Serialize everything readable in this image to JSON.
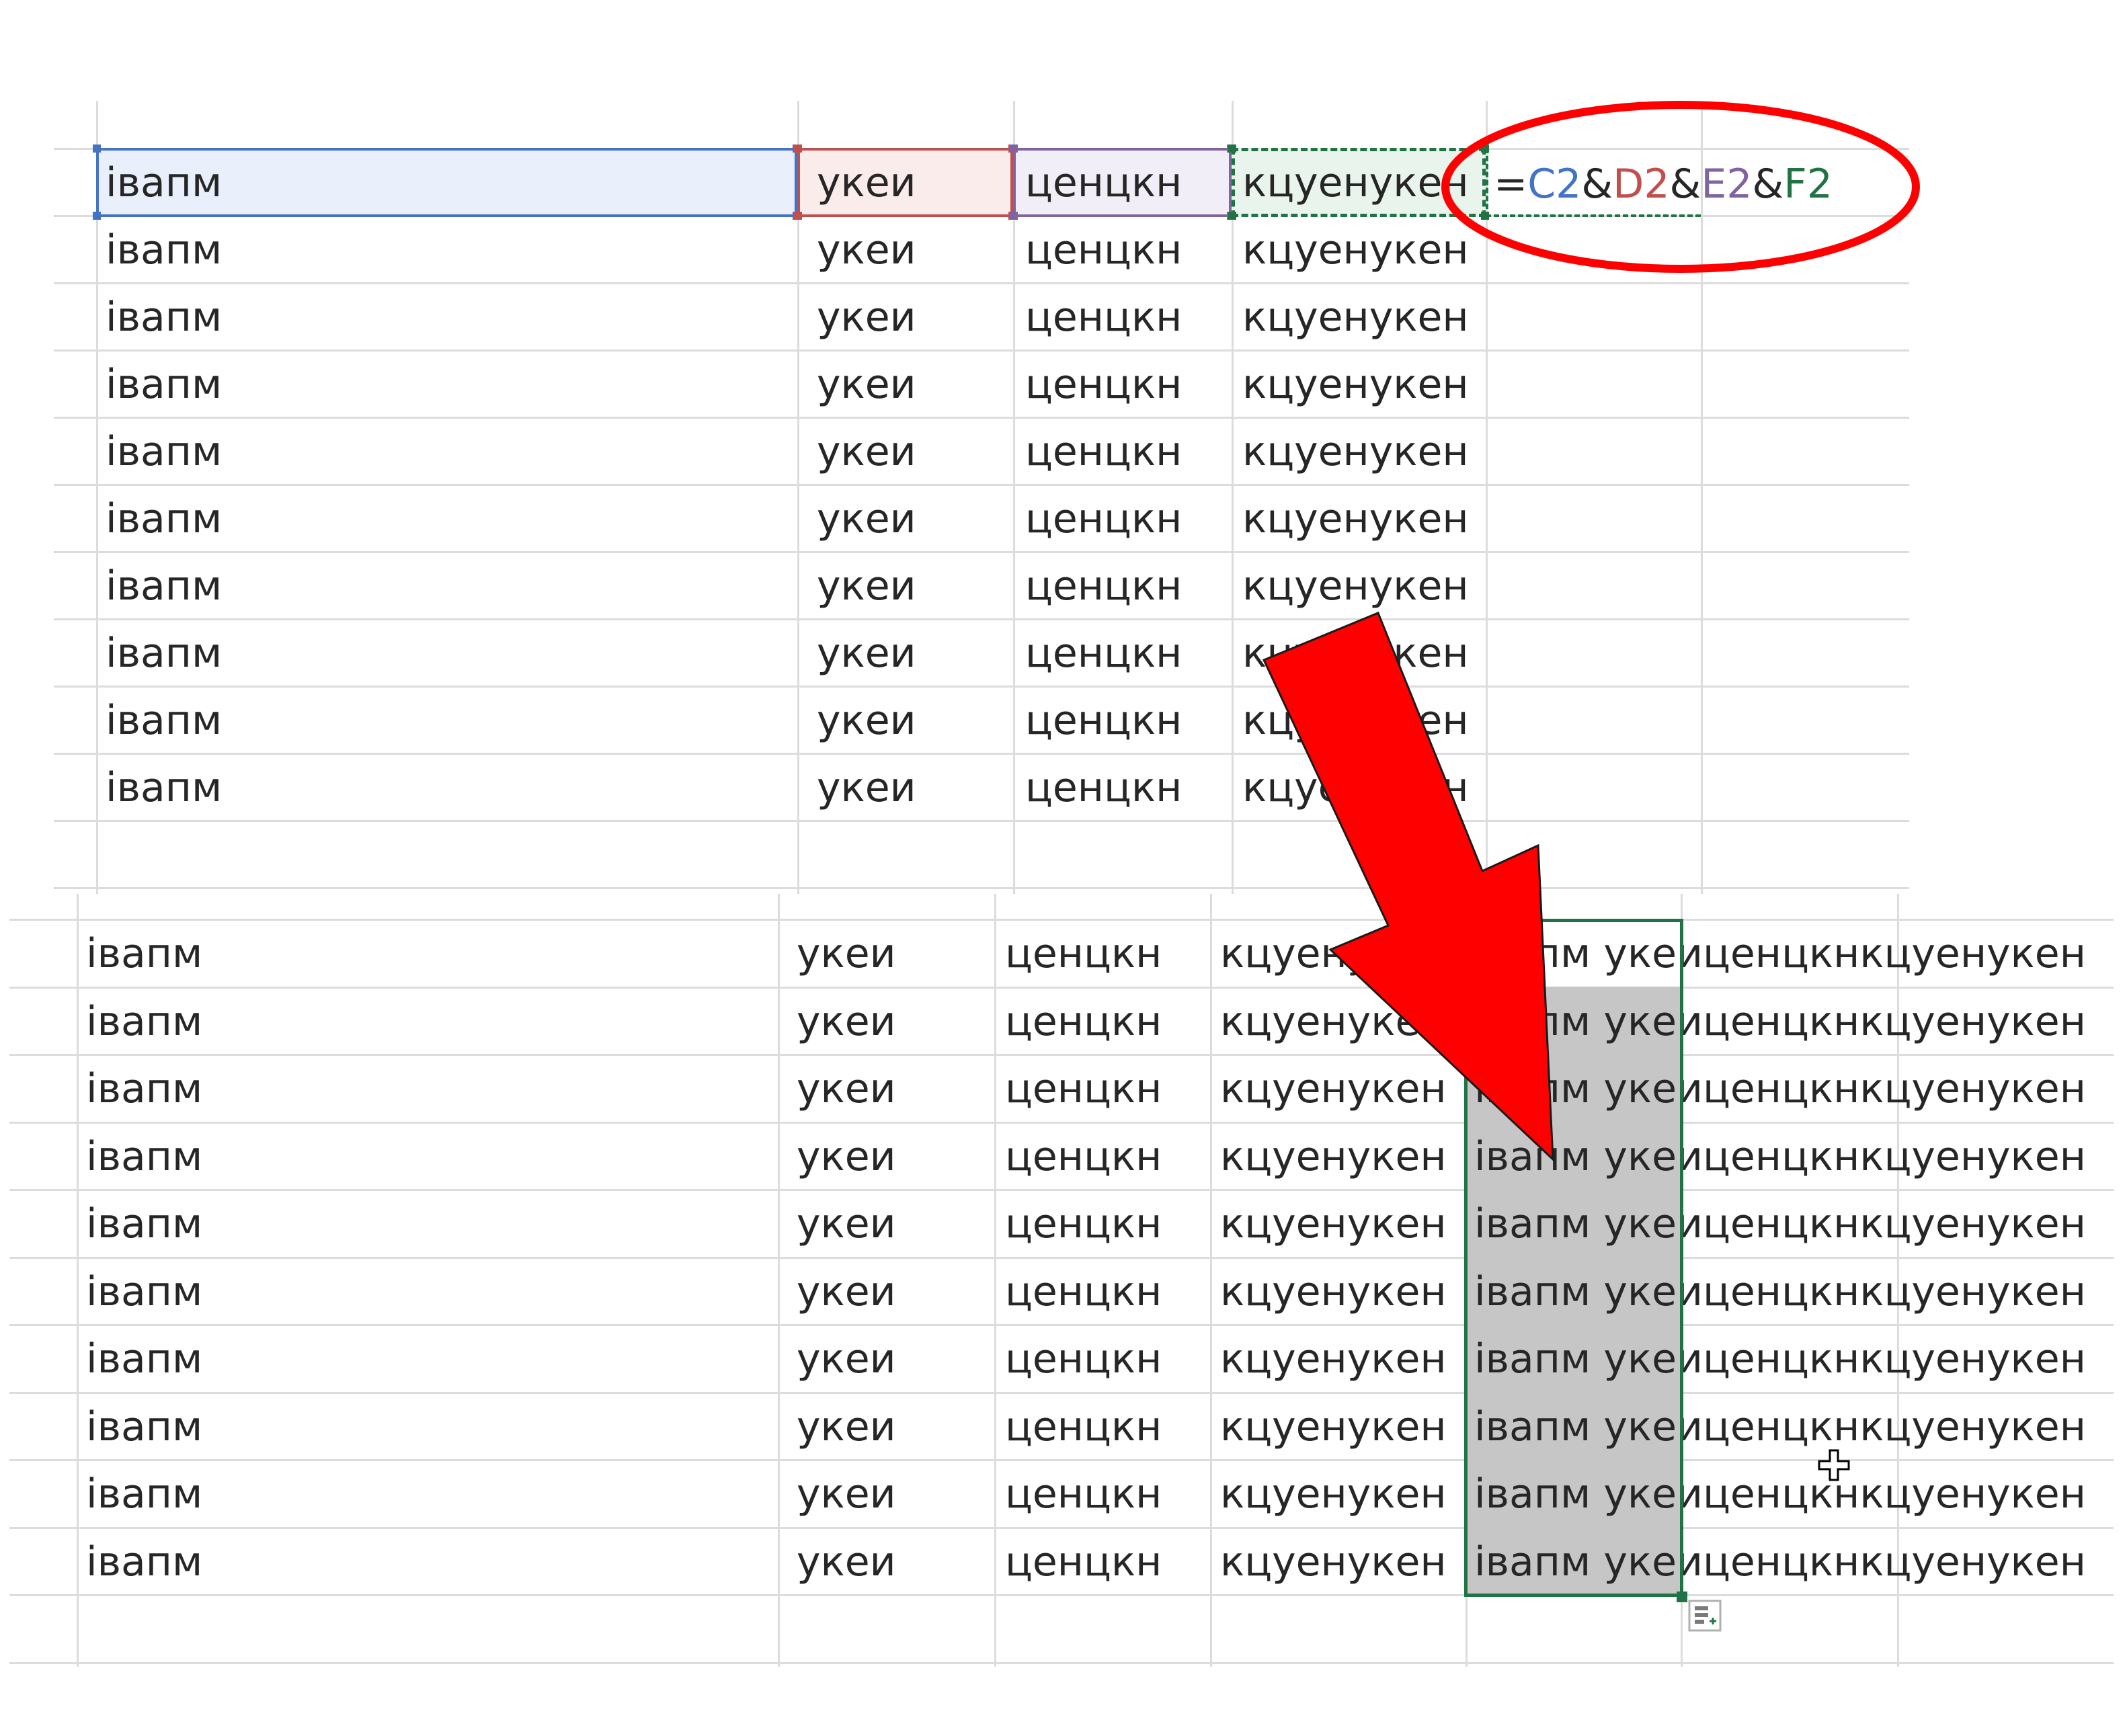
{
  "top_sheet": {
    "rows": [
      [
        "іваnм",
        "укеи",
        "ценцкн",
        "кцуенукен"
      ]
    ],
    "row_count": 10,
    "values": {
      "a": "івапм",
      "b": "укеи",
      "c": "ценцкн",
      "d": "кцуенукен"
    },
    "formula": {
      "eq": "=",
      "ref1": "C2",
      "amp1": "&",
      "ref2": "D2",
      "amp2": "&",
      "ref3": "E2",
      "amp3": "&",
      "ref4": "F2"
    },
    "colors": {
      "ref1": "#4472c4",
      "ref2": "#c0504d",
      "ref3": "#8064a2",
      "ref4": "#217346"
    }
  },
  "bottom_sheet": {
    "row_count": 10,
    "values": {
      "a": "івапм",
      "b": "укеи",
      "c": "ценцкн",
      "d": "кцуенукен",
      "result": "івапм укеиценцкнкцуенукен"
    }
  },
  "colors": {
    "selection": "#217346",
    "annotation": "#ff0000",
    "text": "#262626"
  }
}
